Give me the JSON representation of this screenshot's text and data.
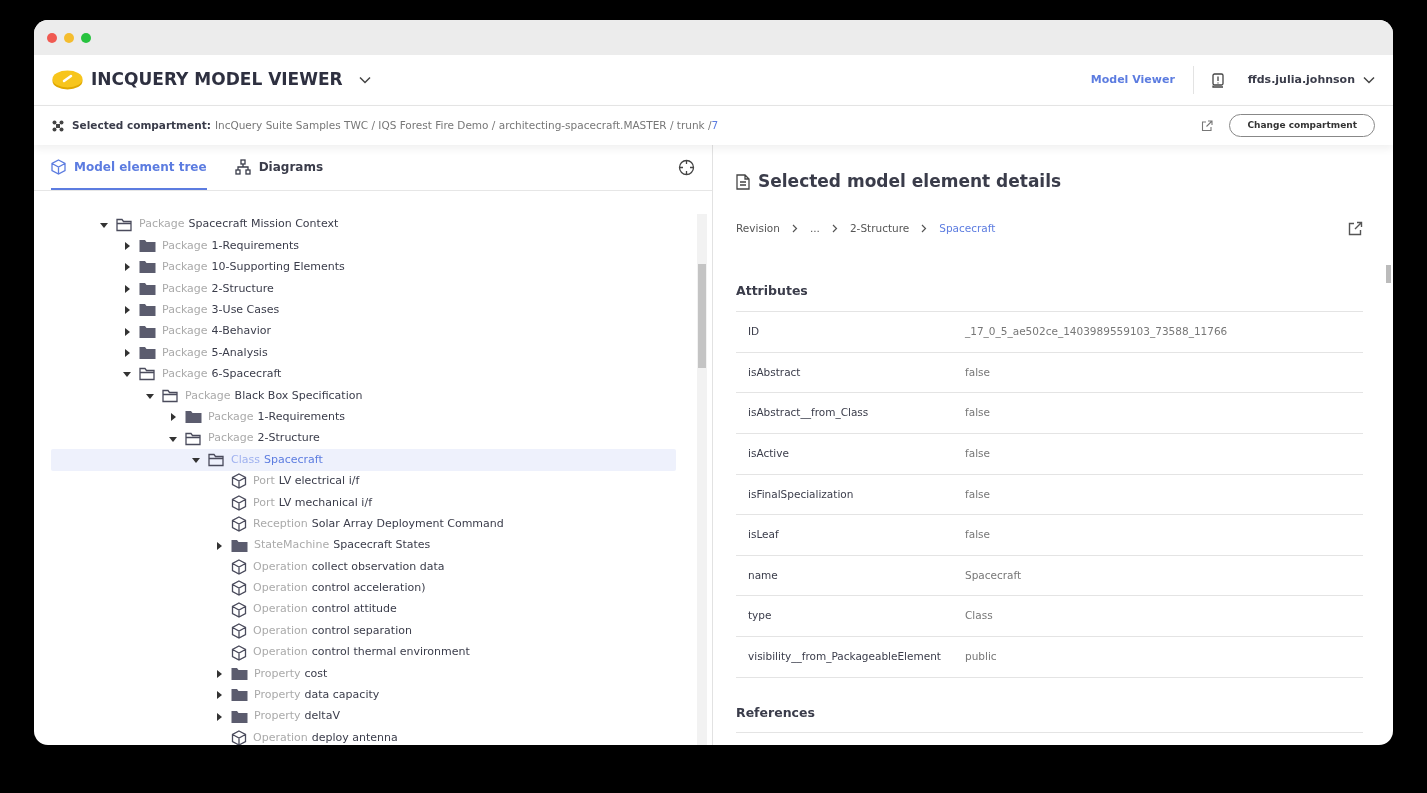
{
  "app": {
    "title": "INCQUERY MODEL VIEWER",
    "nav_link": "Model Viewer",
    "user": "ffds.julia.johnson"
  },
  "compartment": {
    "label": "Selected compartment:",
    "path": "IncQuery Suite Samples TWC / IQS Forest Fire Demo / architecting-spacecraft.MASTER / trunk / ",
    "revision": "7",
    "button": "Change compartment"
  },
  "tabs": [
    {
      "label": "Model element tree",
      "selected": true
    },
    {
      "label": "Diagrams",
      "selected": false
    }
  ],
  "tree": [
    {
      "kind": "container",
      "type": "Package",
      "name": "Spacecraft Mission Context",
      "expanded": true,
      "selected": false,
      "children": [
        {
          "kind": "container",
          "type": "Package",
          "name": "1-Requirements",
          "expanded": false,
          "selected": false
        },
        {
          "kind": "container",
          "type": "Package",
          "name": "10-Supporting Elements",
          "expanded": false,
          "selected": false
        },
        {
          "kind": "container",
          "type": "Package",
          "name": "2-Structure",
          "expanded": false,
          "selected": false
        },
        {
          "kind": "container",
          "type": "Package",
          "name": "3-Use Cases",
          "expanded": false,
          "selected": false
        },
        {
          "kind": "container",
          "type": "Package",
          "name": "4-Behavior",
          "expanded": false,
          "selected": false
        },
        {
          "kind": "container",
          "type": "Package",
          "name": "5-Analysis",
          "expanded": false,
          "selected": false
        },
        {
          "kind": "container",
          "type": "Package",
          "name": "6-Spacecraft",
          "expanded": true,
          "selected": false,
          "children": [
            {
              "kind": "container",
              "type": "Package",
              "name": "Black Box Specification",
              "expanded": true,
              "selected": false,
              "children": [
                {
                  "kind": "container",
                  "type": "Package",
                  "name": "1-Requirements",
                  "expanded": false,
                  "selected": false
                },
                {
                  "kind": "container",
                  "type": "Package",
                  "name": "2-Structure",
                  "expanded": true,
                  "selected": false,
                  "children": [
                    {
                      "kind": "container",
                      "type": "Class",
                      "name": "Spacecraft",
                      "expanded": true,
                      "selected": true,
                      "children": [
                        {
                          "kind": "element",
                          "type": "Port",
                          "name": "LV electrical i/f",
                          "selected": false
                        },
                        {
                          "kind": "element",
                          "type": "Port",
                          "name": "LV mechanical i/f",
                          "selected": false
                        },
                        {
                          "kind": "element",
                          "type": "Reception",
                          "name": "Solar Array Deployment Command",
                          "selected": false
                        },
                        {
                          "kind": "container",
                          "type": "StateMachine",
                          "name": "Spacecraft States",
                          "expanded": false,
                          "selected": false
                        },
                        {
                          "kind": "element",
                          "type": "Operation",
                          "name": "collect observation data",
                          "selected": false
                        },
                        {
                          "kind": "element",
                          "type": "Operation",
                          "name": "control acceleration)",
                          "selected": false
                        },
                        {
                          "kind": "element",
                          "type": "Operation",
                          "name": "control attitude",
                          "selected": false
                        },
                        {
                          "kind": "element",
                          "type": "Operation",
                          "name": "control separation",
                          "selected": false
                        },
                        {
                          "kind": "element",
                          "type": "Operation",
                          "name": "control thermal environment",
                          "selected": false
                        },
                        {
                          "kind": "container",
                          "type": "Property",
                          "name": "cost",
                          "expanded": false,
                          "selected": false
                        },
                        {
                          "kind": "container",
                          "type": "Property",
                          "name": "data capacity",
                          "expanded": false,
                          "selected": false
                        },
                        {
                          "kind": "container",
                          "type": "Property",
                          "name": "deltaV",
                          "expanded": false,
                          "selected": false
                        },
                        {
                          "kind": "element",
                          "type": "Operation",
                          "name": "deploy antenna",
                          "selected": false
                        }
                      ]
                    }
                  ]
                }
              ]
            }
          ]
        }
      ]
    }
  ],
  "details": {
    "title": "Selected model element details",
    "breadcrumb": [
      {
        "label": "Revision",
        "current": false
      },
      {
        "label": "...",
        "current": false
      },
      {
        "label": "2-Structure",
        "current": false
      },
      {
        "label": "Spacecraft",
        "current": true
      }
    ],
    "attributes_heading": "Attributes",
    "attributes": [
      {
        "key": "ID",
        "value": "_17_0_5_ae502ce_1403989559103_73588_11766"
      },
      {
        "key": "isAbstract",
        "value": "false"
      },
      {
        "key": "isAbstract__from_Class",
        "value": "false"
      },
      {
        "key": "isActive",
        "value": "false"
      },
      {
        "key": "isFinalSpecialization",
        "value": "false"
      },
      {
        "key": "isLeaf",
        "value": "false"
      },
      {
        "key": "name",
        "value": "Spacecraft"
      },
      {
        "key": "type",
        "value": "Class"
      },
      {
        "key": "visibility__from_PackageableElement",
        "value": "public"
      }
    ],
    "references_heading": "References"
  }
}
